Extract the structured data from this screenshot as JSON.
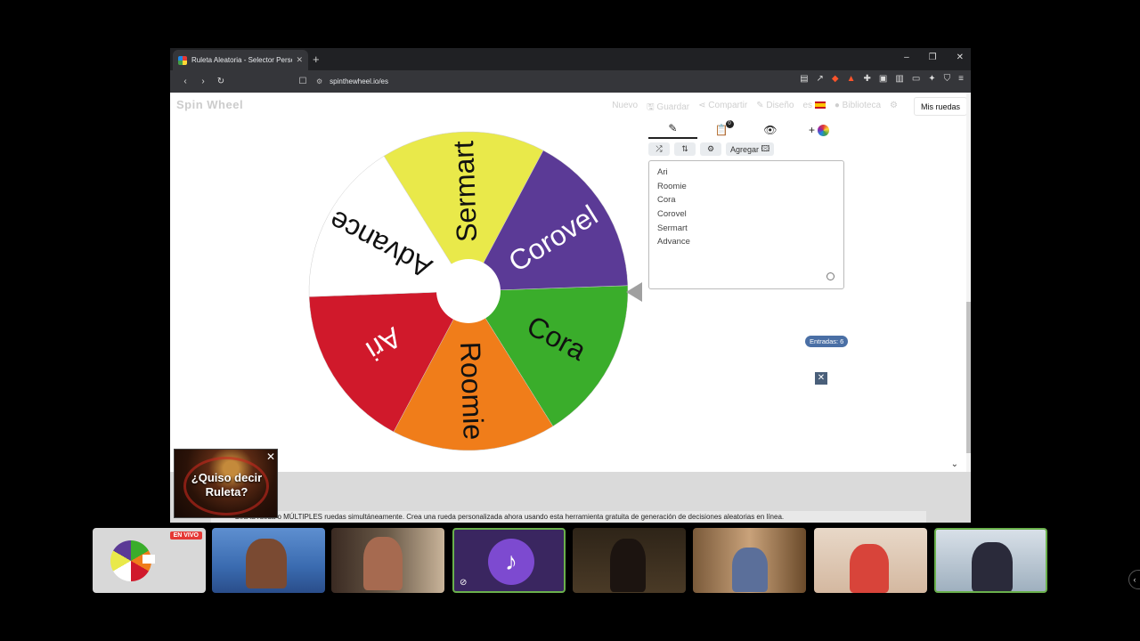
{
  "browser": {
    "tab_title": "Ruleta Aleatoria - Selector Perso",
    "url": "spinthewheel.io/es",
    "new_tab": "+",
    "window_controls": [
      "–",
      "❐",
      "✕"
    ]
  },
  "site": {
    "logo": "Spin Wheel",
    "menu": [
      "Nuevo",
      "Guardar",
      "Compartir",
      "Diseño",
      "es",
      "Biblioteca"
    ],
    "my_wheels": "Mis ruedas"
  },
  "editor": {
    "tabs_badge": "0",
    "add_button": "Agregar",
    "entries": [
      "Ari",
      "Roomie",
      "Cora",
      "Corovel",
      "Sermart",
      "Advance"
    ],
    "entries_count": "Entradas: 6"
  },
  "wheel": {
    "segments": [
      {
        "label": "Cora",
        "color": "#3aad2b"
      },
      {
        "label": "Roomie",
        "color": "#f07d1a"
      },
      {
        "label": "Ari",
        "color": "#d0192b"
      },
      {
        "label": "Advance",
        "color": "#ffffff"
      },
      {
        "label": "Sermart",
        "color": "#e9e94a"
      },
      {
        "label": "Corovel",
        "color": "#5b3a96"
      }
    ]
  },
  "footer": {
    "text": "Gira la rueda o MÚLTIPLES ruedas simultáneamente. Crea una rueda personalizada ahora usando esta herramienta gratuita de generación de decisiones aleatorias en línea."
  },
  "ad": {
    "text": "¿Quiso decir Ruleta?"
  },
  "call": {
    "live_badge": "EN VIVO"
  }
}
